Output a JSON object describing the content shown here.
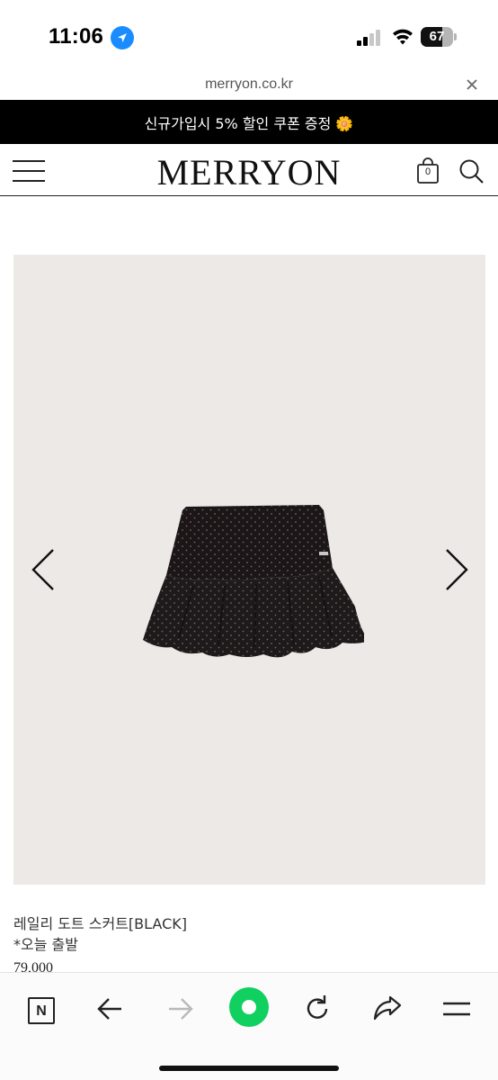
{
  "status_bar": {
    "time": "11:06",
    "battery_level": "67",
    "battery_fraction": 0.67,
    "icons": [
      "location-arrow-icon",
      "cellular-signal-icon",
      "wifi-icon",
      "battery-icon"
    ]
  },
  "browser": {
    "url": "merryon.co.kr",
    "close_icon": "close-icon"
  },
  "promo": {
    "text": "신규가입시 5% 할인 쿠폰 증정 🌼"
  },
  "header": {
    "logo": "MERRYON",
    "cart_count": "0",
    "icons": [
      "hamburger-menu-icon",
      "shopping-bag-icon",
      "search-icon"
    ]
  },
  "product": {
    "name": "레일리 도트 스커트[BLACK]",
    "note": "*오늘 출발",
    "price": "79,000",
    "image_bg": "#ede9e6",
    "icons": [
      "chevron-left-icon",
      "chevron-right-icon"
    ]
  },
  "toolbar": {
    "icons": [
      "naver-n-icon",
      "back-arrow-icon",
      "forward-arrow-icon",
      "green-home-icon",
      "refresh-icon",
      "share-icon",
      "menu-icon"
    ],
    "accent": "#10d060"
  }
}
